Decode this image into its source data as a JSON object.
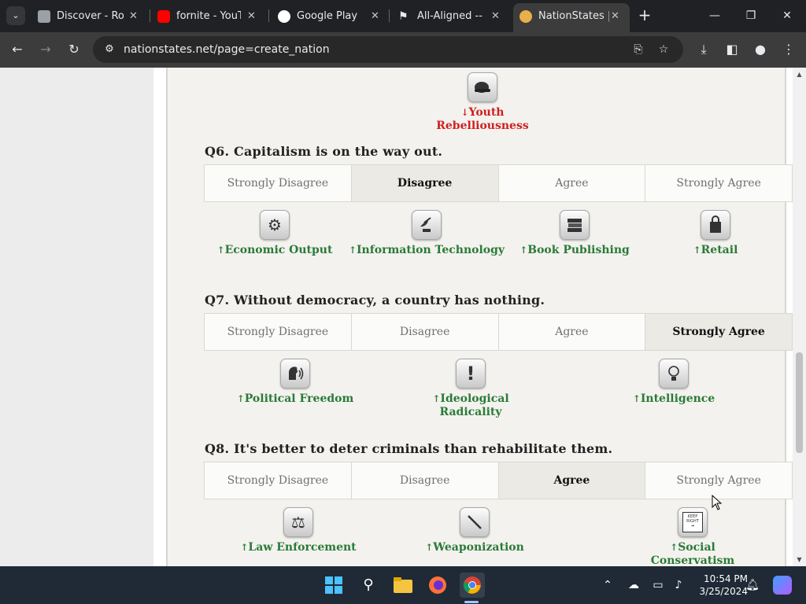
{
  "browser": {
    "tabs": [
      {
        "title": "Discover - Rob",
        "favicon": "roblox-icon",
        "color": "#9aa0a6"
      },
      {
        "title": "fornite - YouTu",
        "favicon": "youtube-icon",
        "color": "#ff0000"
      },
      {
        "title": "Google Play",
        "favicon": "google-icon",
        "color": "#ffffff"
      },
      {
        "title": "All-Aligned -- |",
        "favicon": "flag-icon",
        "color": "#e8eaed"
      },
      {
        "title": "NationStates |",
        "favicon": "nationstates-icon",
        "color": "#e8b04a"
      }
    ],
    "url": "nationstates.net/page=create_nation"
  },
  "options": [
    "Strongly Disagree",
    "Disagree",
    "Agree",
    "Strongly Agree"
  ],
  "partial": {
    "effect": {
      "arrow": "↓",
      "label": "Youth Rebelliousness",
      "icon": "cap-icon",
      "direction": "down"
    }
  },
  "questions": [
    {
      "number": "Q6.",
      "text": "Capitalism is on the way out.",
      "selected": 1,
      "effects": [
        {
          "arrow": "↑",
          "label": "Economic Output",
          "icon": "gear-icon"
        },
        {
          "arrow": "↑",
          "label": "Information Technology",
          "icon": "satellite-dish-icon"
        },
        {
          "arrow": "↑",
          "label": "Book Publishing",
          "icon": "books-icon"
        },
        {
          "arrow": "↑",
          "label": "Retail",
          "icon": "shopping-bag-icon"
        }
      ]
    },
    {
      "number": "Q7.",
      "text": "Without democracy, a country has nothing.",
      "selected": 3,
      "effects": [
        {
          "arrow": "↑",
          "label": "Political Freedom",
          "icon": "speaking-head-icon"
        },
        {
          "arrow": "↑",
          "label": "Ideological Radicality",
          "icon": "exclamation-icon"
        },
        {
          "arrow": "↑",
          "label": "Intelligence",
          "icon": "lightbulb-icon"
        }
      ]
    },
    {
      "number": "Q8.",
      "text": "It's better to deter criminals than rehabilitate them.",
      "selected": 2,
      "effects": [
        {
          "arrow": "↑",
          "label": "Law Enforcement",
          "icon": "scales-icon"
        },
        {
          "arrow": "↑",
          "label": "Weaponization",
          "icon": "sword-icon"
        },
        {
          "arrow": "↑",
          "label": "Social Conservatism",
          "icon": "keep-right-sign-icon"
        }
      ]
    }
  ],
  "sign_text": "KEEP RIGHT",
  "taskbar": {
    "time": "10:54 PM",
    "date": "3/25/2024"
  }
}
